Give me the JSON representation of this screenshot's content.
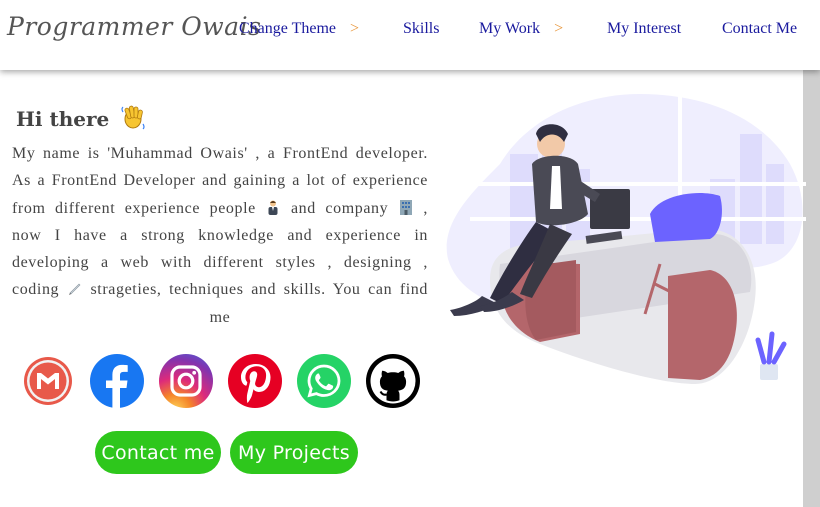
{
  "header": {
    "logo": "Programmer Owais",
    "nav": {
      "change_theme": "Change Theme",
      "skills": "Skills",
      "my_work": "My Work",
      "my_interest": "My Interest",
      "contact_me": "Contact Me",
      "arrow": ">"
    }
  },
  "intro": {
    "greeting": "Hi there",
    "bio_part1": "My name is 'Muhammad Owais' , a FrontEnd developer. As a FrontEnd Developer and gaining a lot of experience from different experience people",
    "bio_part2": "and company",
    "bio_part3": ", now I have a strong knowledge and experience in developing a web with different styles , designing , coding",
    "bio_part4": "strageties, techniques and skills. You can find me"
  },
  "social": {
    "icons": [
      "gmail-icon",
      "facebook-icon",
      "instagram-icon",
      "pinterest-icon",
      "whatsapp-icon",
      "github-icon"
    ]
  },
  "buttons": {
    "contact": "Contact me",
    "projects": "My Projects"
  },
  "colors": {
    "nav_text": "#1a1a9e",
    "nav_arrow": "#e8963a",
    "button_bg": "#2ec71c",
    "illustration_accent": "#6c63ff"
  }
}
